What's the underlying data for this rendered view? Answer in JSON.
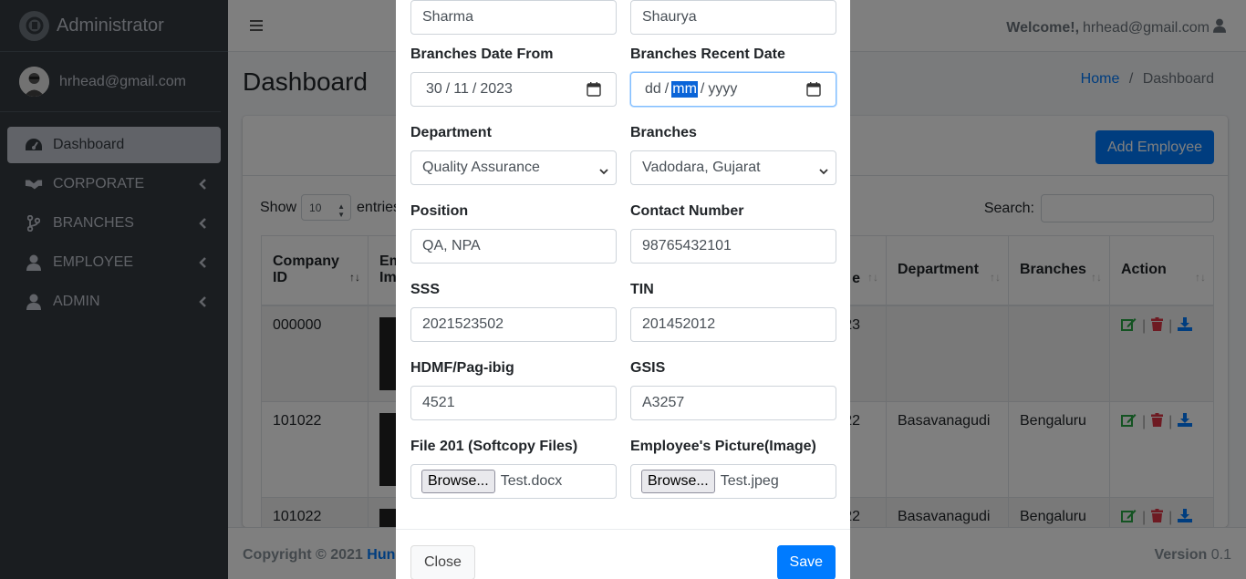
{
  "sidebar": {
    "brand": "Administrator",
    "user": "hrhead@gmail.com",
    "items": [
      {
        "label": "Dashboard"
      },
      {
        "label": "CORPORATE"
      },
      {
        "label": "BRANCHES"
      },
      {
        "label": "EMPLOYEE"
      },
      {
        "label": "ADMIN"
      }
    ]
  },
  "topbar": {
    "welcome_prefix": "Welcome!,",
    "welcome_user": "hrhead@gmail.com"
  },
  "header": {
    "title": "Dashboard",
    "breadcrumb_home": "Home",
    "breadcrumb_sep": "/",
    "breadcrumb_current": "Dashboard"
  },
  "card": {
    "add_button": "Add Employee",
    "show_label": "Show",
    "show_value": "10",
    "entries_label": "entries",
    "search_label": "Search:",
    "columns": {
      "company_id_1": "Company",
      "company_id_2": "ID",
      "emp_image_1": "Em",
      "emp_image_2": "Im",
      "partial": "e",
      "department": "Department",
      "branches": "Branches",
      "action": "Action"
    },
    "rows": [
      {
        "company_id": "000000",
        "partial": "23",
        "department": "",
        "branches": ""
      },
      {
        "company_id": "101022",
        "partial": "22",
        "department": "Basavanagudi",
        "branches": "Bengaluru"
      },
      {
        "company_id": "101022",
        "partial": "22",
        "department": "Basavanagudi",
        "branches": "Bengaluru"
      }
    ],
    "action_sep": "|"
  },
  "footer": {
    "copyright": "Copyright © 2021",
    "link": "Hun",
    "version_label": "Version",
    "version": "0.1"
  },
  "modal": {
    "last_name": "Sharma",
    "first_name": "Shaurya",
    "date_from_label": "Branches Date From",
    "date_from": {
      "dd": "30",
      "mm": "11",
      "yyyy": "2023"
    },
    "recent_date_label": "Branches Recent Date",
    "recent_date": {
      "dd": "dd",
      "mm": "mm",
      "yyyy": "yyyy"
    },
    "date_sep": "/",
    "department_label": "Department",
    "department_value": "Quality Assurance",
    "branches_label": "Branches",
    "branches_value": "Vadodara, Gujarat",
    "position_label": "Position",
    "position_value": "QA, NPA",
    "contact_label": "Contact Number",
    "contact_value": "98765432101",
    "sss_label": "SSS",
    "sss_value": "2021523502",
    "tin_label": "TIN",
    "tin_value": "201452012",
    "hdmf_label": "HDMF/Pag-ibig",
    "hdmf_value": "4521",
    "gsis_label": "GSIS",
    "gsis_value": "A3257",
    "file201_label": "File 201 (Softcopy Files)",
    "file201_button": "Browse...",
    "file201_value": "Test.docx",
    "picture_label": "Employee's Picture(Image)",
    "picture_button": "Browse...",
    "picture_value": "Test.jpeg",
    "close_button": "Close",
    "save_button": "Save"
  }
}
